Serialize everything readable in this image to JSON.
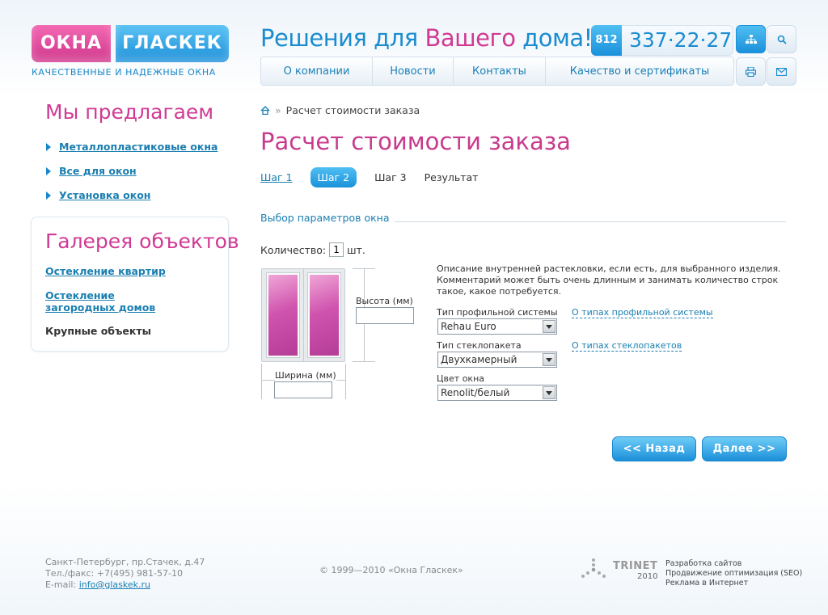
{
  "header": {
    "logo_left": "ОКНА",
    "logo_right": "ГЛАСКЕК",
    "tagline": "КАЧЕСТВЕННЫЕ И НАДЕЖНЫЕ ОКНА",
    "slogan_part1": "Решения для ",
    "slogan_accent": "Вашего",
    "slogan_part2": " дома!",
    "phone_code": "812",
    "phone_number": "337·22·27"
  },
  "nav": [
    {
      "label": "О компании"
    },
    {
      "label": "Новости"
    },
    {
      "label": "Контакты"
    },
    {
      "label": "Качество и сертификаты"
    }
  ],
  "sidebar": {
    "offer_title": "Мы предлагаем",
    "offer_items": [
      {
        "label": "Металлопластиковые окна"
      },
      {
        "label": "Все для окон"
      },
      {
        "label": "Установка окон"
      }
    ],
    "gallery_title": "Галерея объектов",
    "gallery_items": [
      {
        "label": "Остекление квартир"
      },
      {
        "label_line1": "Остекление",
        "label_line2": "загородных домов"
      },
      {
        "label": "Крупные объекты"
      }
    ]
  },
  "main": {
    "breadcrumb_sep": "»",
    "breadcrumb_current": "Расчет стоимости заказа",
    "title": "Расчет стоимости заказа",
    "steps": [
      {
        "label": "Шаг 1"
      },
      {
        "label": "Шаг 2"
      },
      {
        "label": "Шаг 3"
      },
      {
        "label": "Результат"
      }
    ],
    "section_title": "Выбор параметров окна",
    "quantity_label": "Количество:",
    "quantity_value": "1",
    "quantity_unit": "шт.",
    "height_label": "Высота (мм)",
    "width_label": "Ширина (мм)",
    "description": "Описание внутренней растекловки, если есть, для выбранного изделия. Комментарий может быть очень длинным и занимать количество строк такое, какое потребуется.",
    "profile_label": "Тип профильной системы",
    "profile_value": "Rehau Euro",
    "profile_link": "О типах профильной системы",
    "glass_label": "Тип стеклопакета",
    "glass_value": "Двухкамерный",
    "glass_link": "О типах стеклопакетов",
    "color_label": "Цвет окна",
    "color_value": "Renolit/белый",
    "back_button": "<< Назад",
    "next_button": "Далее >>"
  },
  "footer": {
    "address": "Санкт-Петербург, пр.Стачек, д.47",
    "phone": "Тел./факс: +7(495) 981-57-10",
    "email_label": "E-mail:",
    "email": "info@glaskek.ru",
    "copyright": "© 1999—2010 «Окна Гласкек»",
    "trinet_name": "TRINET",
    "trinet_year": "2010",
    "services": [
      "Разработка сайтов",
      "Продвижение оптимизация (SEO)",
      "Реклама в Интернет"
    ]
  },
  "colors": {
    "brand_pink": "#d03a93",
    "brand_blue": "#1a8ccf"
  },
  "icons": [
    "sitemap-icon",
    "search-icon",
    "print-icon",
    "mail-icon",
    "home-icon",
    "trinet-logo-icon"
  ]
}
